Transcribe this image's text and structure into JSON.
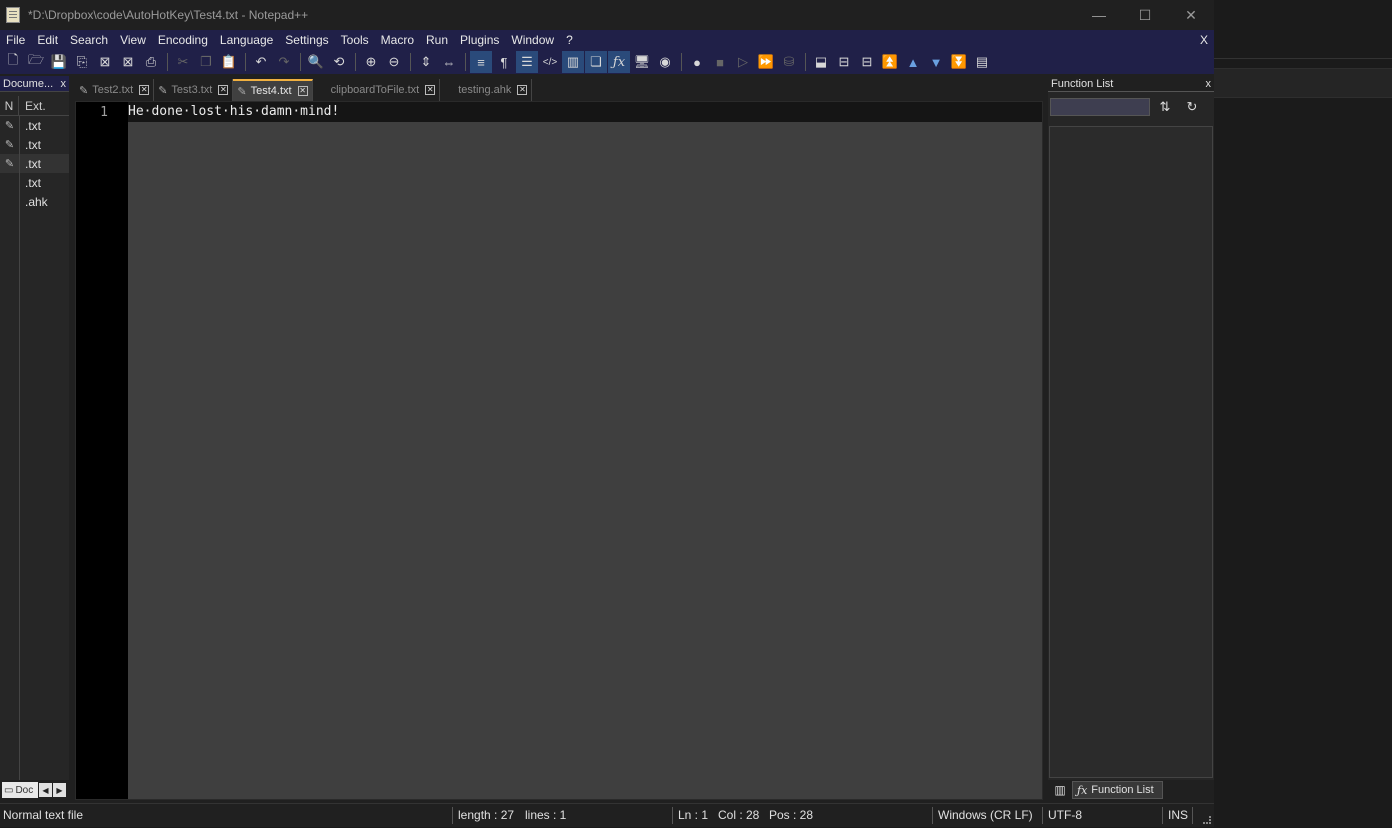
{
  "window": {
    "title": "*D:\\Dropbox\\code\\AutoHotKey\\Test4.txt - Notepad++",
    "controls": {
      "minimize": "—",
      "maximize": "☐",
      "close": "✕"
    }
  },
  "menu": {
    "items": [
      "File",
      "Edit",
      "Search",
      "View",
      "Encoding",
      "Language",
      "Settings",
      "Tools",
      "Macro",
      "Run",
      "Plugins",
      "Window",
      "?"
    ],
    "close_label": "X"
  },
  "toolbar": {
    "buttons": [
      {
        "name": "new-file",
        "icon": "🗋"
      },
      {
        "name": "open-file",
        "icon": "🗁"
      },
      {
        "name": "save",
        "icon": "💾"
      },
      {
        "name": "save-all",
        "icon": "⎘"
      },
      {
        "name": "close",
        "icon": "⊠"
      },
      {
        "name": "close-all",
        "icon": "⊠"
      },
      {
        "name": "print",
        "icon": "⎙"
      },
      {
        "name": "cut",
        "icon": "✂"
      },
      {
        "name": "copy",
        "icon": "❐"
      },
      {
        "name": "paste",
        "icon": "📋"
      },
      {
        "name": "undo",
        "icon": "↶"
      },
      {
        "name": "redo",
        "icon": "↷"
      },
      {
        "name": "find",
        "icon": "🔍"
      },
      {
        "name": "replace",
        "icon": "⟲"
      },
      {
        "name": "zoom-in",
        "icon": "⊕"
      },
      {
        "name": "zoom-out",
        "icon": "⊖"
      },
      {
        "name": "sync-vertical",
        "icon": "⇕"
      },
      {
        "name": "sync-horizontal",
        "icon": "⇔"
      },
      {
        "name": "word-wrap",
        "icon": "≡"
      },
      {
        "name": "show-all-chars",
        "icon": "¶"
      },
      {
        "name": "indent-guide",
        "icon": "☰"
      },
      {
        "name": "xml-tags",
        "icon": "</>"
      },
      {
        "name": "document-map",
        "icon": "▥"
      },
      {
        "name": "document-list",
        "icon": "❏"
      },
      {
        "name": "function-list",
        "icon": "ƒx"
      },
      {
        "name": "folder-workspace",
        "icon": "🖥"
      },
      {
        "name": "monitoring",
        "icon": "◉"
      },
      {
        "name": "record-macro",
        "icon": "●"
      },
      {
        "name": "stop-recording",
        "icon": "■"
      },
      {
        "name": "playback-macro",
        "icon": "▷"
      },
      {
        "name": "run-macro-multiple",
        "icon": "⏩"
      },
      {
        "name": "save-macro",
        "icon": "⛁"
      },
      {
        "name": "compare",
        "icon": "⬓"
      },
      {
        "name": "compare-side",
        "icon": "⊟"
      },
      {
        "name": "clear-compare",
        "icon": "⊟"
      },
      {
        "name": "first-diff",
        "icon": "⏫"
      },
      {
        "name": "prev-diff",
        "icon": "▲"
      },
      {
        "name": "next-diff",
        "icon": "▼"
      },
      {
        "name": "last-diff",
        "icon": "⏬"
      },
      {
        "name": "compare-options",
        "icon": "▤"
      }
    ]
  },
  "doc_switcher": {
    "title": "Docume...",
    "close_label": "x",
    "col_n": "N",
    "col_ext": "Ext.",
    "rows": [
      {
        "ext": ".txt",
        "modified": true
      },
      {
        "ext": ".txt",
        "modified": true
      },
      {
        "ext": ".txt",
        "modified": true
      },
      {
        "ext": ".txt",
        "modified": false
      },
      {
        "ext": ".ahk",
        "modified": false
      }
    ],
    "footer_tab": "Doc"
  },
  "tabs": [
    {
      "label": "Test2.txt",
      "modified": true,
      "active": false
    },
    {
      "label": "Test3.txt",
      "modified": true,
      "active": false
    },
    {
      "label": "Test4.txt",
      "modified": true,
      "active": true
    },
    {
      "label": "clipboardToFile.txt",
      "modified": false,
      "active": false
    },
    {
      "label": "testing.ahk",
      "modified": false,
      "active": false
    }
  ],
  "editor": {
    "line_number": "1",
    "content": "He·done·lost·his·damn·mind!"
  },
  "function_list": {
    "title": "Function List",
    "close_label": "x",
    "sort_icon": "⇅",
    "refresh_icon": "↻",
    "footer_tab": "Function List"
  },
  "status": {
    "file_type": "Normal text file",
    "length": "length : 27",
    "lines": "lines : 1",
    "ln": "Ln : 1",
    "col": "Col : 28",
    "pos": "Pos : 28",
    "eol": "Windows (CR LF)",
    "encoding": "UTF-8",
    "mode": "INS"
  }
}
